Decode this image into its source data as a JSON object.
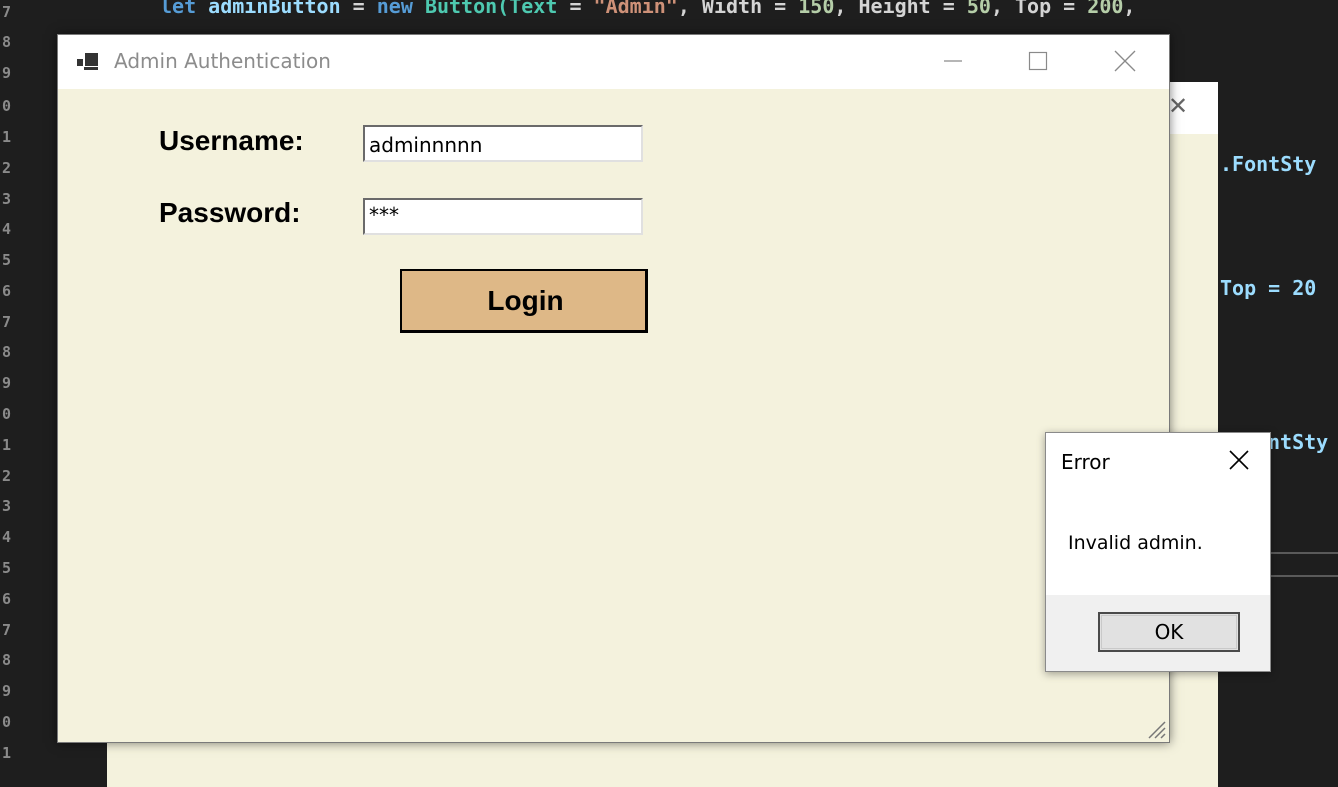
{
  "editor": {
    "line_numbers": [
      "7",
      "8",
      "9",
      "0",
      "1",
      "2",
      "3",
      "4",
      "5",
      "6",
      "7",
      "8",
      "9",
      "0",
      "1",
      "2",
      "3",
      "4",
      "5",
      "6",
      "7",
      "8",
      "9",
      "0",
      "1"
    ],
    "top_line": {
      "let": "let",
      "var": "adminButton",
      "eq": "=",
      "new": "new",
      "cls": "Button(Text",
      "eq2": "=",
      "str": "\"Admin\"",
      "rest_a": ", Width =",
      "n1": "150",
      "rest_b": ", Height =",
      "n2": "50",
      "rest_c": ", Top =",
      "n3": "200",
      "rest_d": ","
    },
    "peek_1": ".FontSty",
    "peek_2": "Top = 20",
    "peek_3": "ntSty"
  },
  "behind_window": {
    "close_glyph": "✕"
  },
  "window": {
    "title": "Admin Authentication",
    "username_label": "Username:",
    "password_label": "Password:",
    "username_value": "adminnnnn",
    "password_value": "***",
    "login_label": "Login"
  },
  "dialog": {
    "title": "Error",
    "message": "Invalid admin.",
    "ok_label": "OK"
  },
  "colors": {
    "form_bg": "#f4f2dd",
    "login_bg": "#deb887",
    "editor_bg": "#1e1e1e"
  }
}
